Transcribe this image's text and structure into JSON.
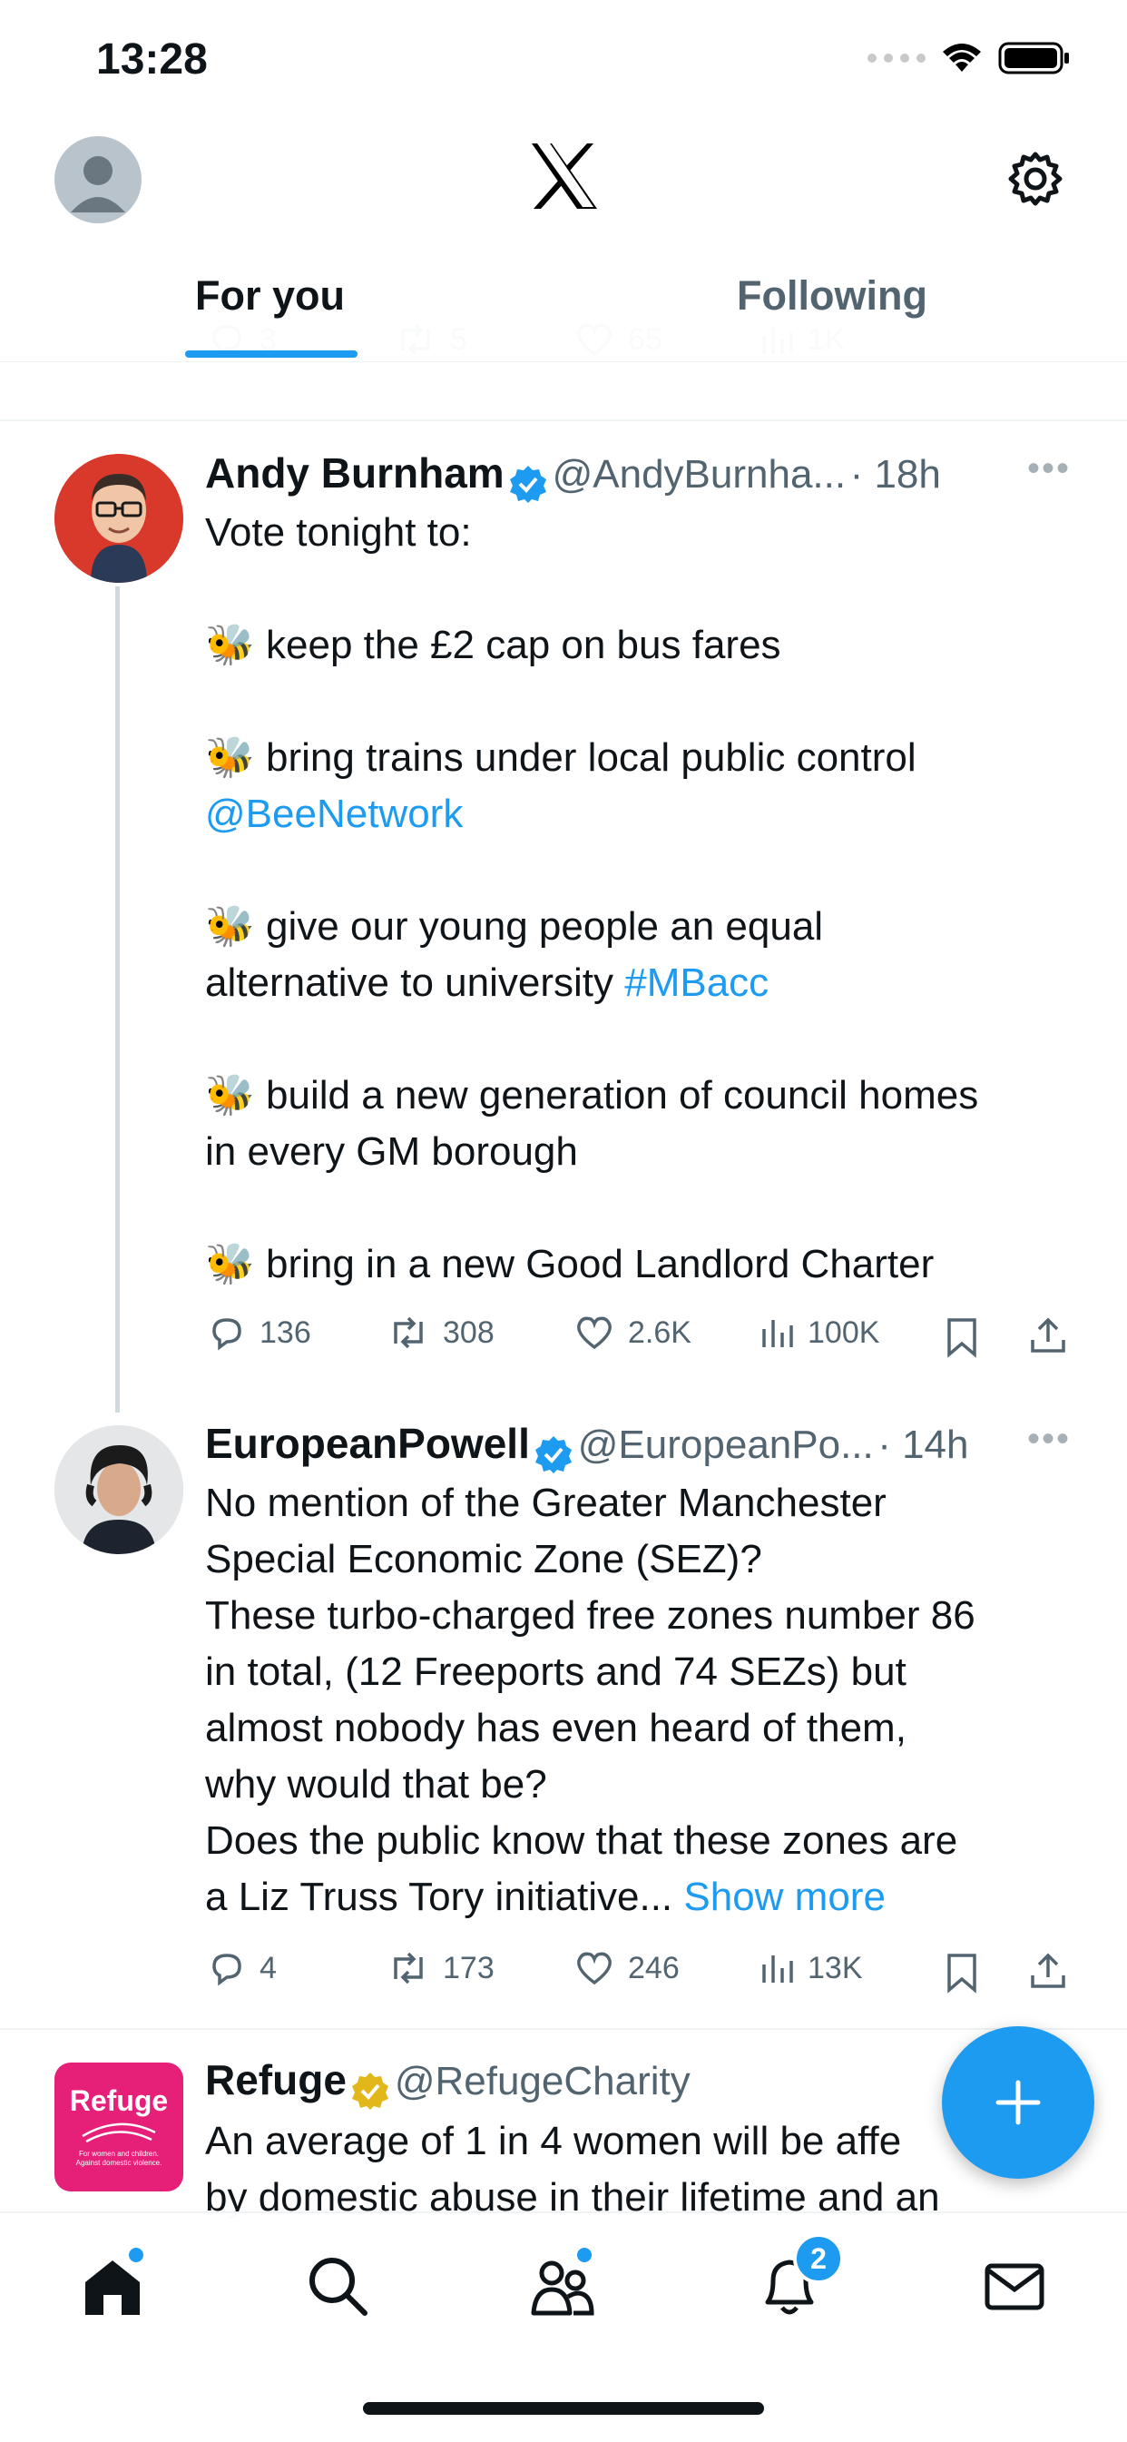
{
  "status_bar": {
    "time": "13:28"
  },
  "header": {
    "tabs": [
      {
        "label": "For you",
        "active": true
      },
      {
        "label": "Following",
        "active": false
      }
    ]
  },
  "previous_tweet_metrics": {
    "replies": "3",
    "reposts": "5",
    "likes": "65",
    "views": "1K"
  },
  "tweets": [
    {
      "name": "Andy Burnham",
      "handle": "@AndyBurnha...",
      "time": "· 18h",
      "lines": {
        "intro": "Vote tonight to:",
        "p1": "keep the £2 cap on bus fares",
        "p2": "bring trains under local public control",
        "p2_link": "@BeeNetwork",
        "p3a": "give our young people an equal",
        "p3b": "alternative to university ",
        "p3_link": "#MBacc",
        "p4a": "build a new generation of council homes",
        "p4b": "in every GM borough",
        "p5": "bring in a new Good Landlord Charter",
        "emoji": "🐝"
      },
      "metrics": {
        "replies": "136",
        "reposts": "308",
        "likes": "2.6K",
        "views": "100K"
      }
    },
    {
      "name": "EuropeanPowell",
      "handle": "@EuropeanPo...",
      "time": "· 14h",
      "lines": [
        "No mention of the Greater Manchester",
        "Special Economic Zone (SEZ)?",
        "These turbo-charged free zones number 86",
        "in total, (12 Freeports and 74 SEZs) but",
        "almost nobody has even heard of them,",
        "why would that be?",
        "Does the public know that these zones are",
        "a Liz Truss Tory initiative..."
      ],
      "show_more": "Show more",
      "metrics": {
        "replies": "4",
        "reposts": "173",
        "likes": "246",
        "views": "13K"
      }
    },
    {
      "name": "Refuge",
      "handle": "@RefugeCharity",
      "logo_text": "Refuge",
      "logo_subtext": "For women and children. Against domestic violence.",
      "lines": [
        "An average of 1 in 4 women will be affe",
        "by domestic abuse in their lifetime and an"
      ]
    }
  ],
  "bottom_nav": {
    "notifications_badge": "2"
  },
  "icons": [
    "avatar-placeholder-icon",
    "x-logo-icon",
    "gear-icon",
    "reply-icon",
    "repost-icon",
    "like-icon",
    "views-icon",
    "bookmark-icon",
    "share-icon",
    "verified-icon",
    "more-icon",
    "compose-plus-icon",
    "home-icon",
    "search-icon",
    "communities-icon",
    "bell-icon",
    "mail-icon"
  ],
  "colors": {
    "accent": "#1d9bf0",
    "text": "#0f1419",
    "secondary": "#536471",
    "refuge": "#e61f78",
    "gold_badge": "#e2b719"
  }
}
